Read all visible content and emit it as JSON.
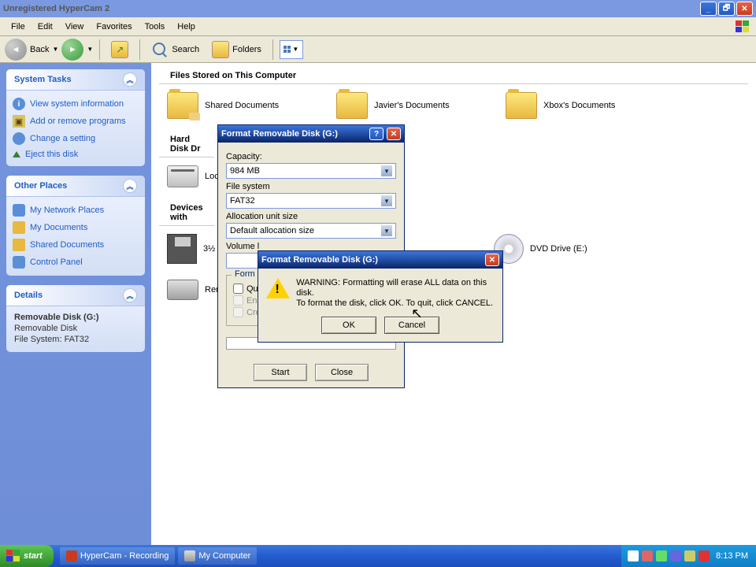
{
  "title": "Unregistered HyperCam 2",
  "menus": {
    "file": "File",
    "edit": "Edit",
    "view": "View",
    "favorites": "Favorites",
    "tools": "Tools",
    "help": "Help"
  },
  "toolbar": {
    "back": "Back",
    "search": "Search",
    "folders": "Folders"
  },
  "sidebar": {
    "system_tasks": {
      "title": "System Tasks",
      "items": [
        "View system information",
        "Add or remove programs",
        "Change a setting",
        "Eject this disk"
      ]
    },
    "other_places": {
      "title": "Other Places",
      "items": [
        "My Network Places",
        "My Documents",
        "Shared Documents",
        "Control Panel"
      ]
    },
    "details": {
      "title": "Details",
      "name": "Removable Disk (G:)",
      "type": "Removable Disk",
      "fs": "File System: FAT32"
    }
  },
  "content": {
    "sec1": "Files Stored on This Computer",
    "folders": [
      "Shared Documents",
      "Javier's Documents",
      "Xbox's Documents"
    ],
    "sec2": "Hard Disk Dr",
    "drives": [
      "Loc"
    ],
    "sec3": "Devices with",
    "dev1": "3½",
    "dev2": "DVD Drive (E:)",
    "dev3": "Rem"
  },
  "format_dlg": {
    "title": "Format Removable Disk (G:)",
    "capacity_label": "Capacity:",
    "capacity": "984 MB",
    "fs_label": "File system",
    "fs": "FAT32",
    "alloc_label": "Allocation unit size",
    "alloc": "Default allocation size",
    "volume_label": "Volume l",
    "volume": "",
    "group": "Form",
    "quick": "Qui",
    "compress": "En",
    "msdos": "Cre",
    "start": "Start",
    "close": "Close"
  },
  "msgbox": {
    "title": "Format Removable Disk (G:)",
    "line1": "WARNING: Formatting will erase ALL data on this disk.",
    "line2": "To format the disk, click OK. To quit, click CANCEL.",
    "ok": "OK",
    "cancel": "Cancel"
  },
  "taskbar": {
    "start": "start",
    "task1": "HyperCam - Recording",
    "task2": "My Computer",
    "time": "8:13 PM"
  }
}
